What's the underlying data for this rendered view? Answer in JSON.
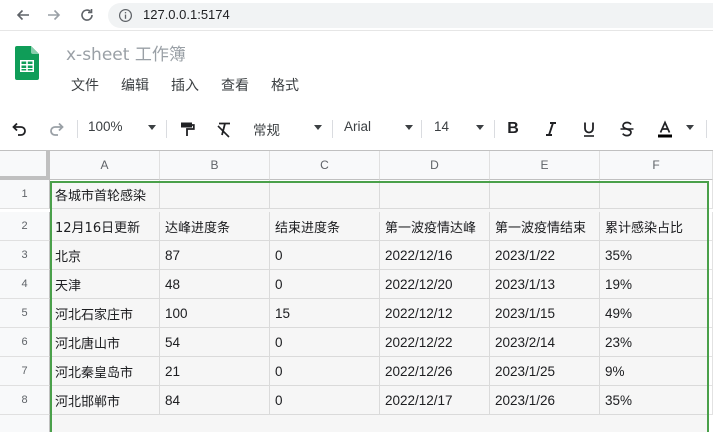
{
  "browser": {
    "url": "127.0.0.1:5174"
  },
  "app": {
    "title": "x-sheet 工作簿"
  },
  "menu": [
    "文件",
    "编辑",
    "插入",
    "查看",
    "格式"
  ],
  "toolbar": {
    "zoom": "100%",
    "format": "常规",
    "font": "Arial",
    "font_size": "14",
    "bold_label": "B"
  },
  "grid": {
    "columns": [
      "A",
      "B",
      "C",
      "D",
      "E",
      "F"
    ],
    "rows": [
      {
        "num": "1",
        "cells": [
          "各城市首轮感染",
          "",
          "",
          "",
          "",
          ""
        ]
      },
      {
        "num": "2",
        "cells": [
          "12月16日更新",
          "达峰进度条",
          "结束进度条",
          "第一波疫情达峰",
          "第一波疫情结束",
          "累计感染占比"
        ]
      },
      {
        "num": "3",
        "cells": [
          "北京",
          "87",
          "0",
          "2022/12/16",
          "2023/1/22",
          "35%"
        ]
      },
      {
        "num": "4",
        "cells": [
          "天津",
          "48",
          "0",
          "2022/12/20",
          "2023/1/13",
          "19%"
        ]
      },
      {
        "num": "5",
        "cells": [
          "河北石家庄市",
          "100",
          "15",
          "2022/12/12",
          "2023/1/15",
          "49%"
        ]
      },
      {
        "num": "6",
        "cells": [
          "河北唐山市",
          "54",
          "0",
          "2022/12/22",
          "2023/2/14",
          "23%"
        ]
      },
      {
        "num": "7",
        "cells": [
          "河北秦皇岛市",
          "21",
          "0",
          "2022/12/26",
          "2023/1/25",
          "9%"
        ]
      },
      {
        "num": "8",
        "cells": [
          "河北邯郸市",
          "84",
          "0",
          "2022/12/17",
          "2023/1/26",
          "35%"
        ]
      }
    ]
  },
  "colors": {
    "selection": "#4aa04a",
    "logo": "#0f9d58"
  }
}
